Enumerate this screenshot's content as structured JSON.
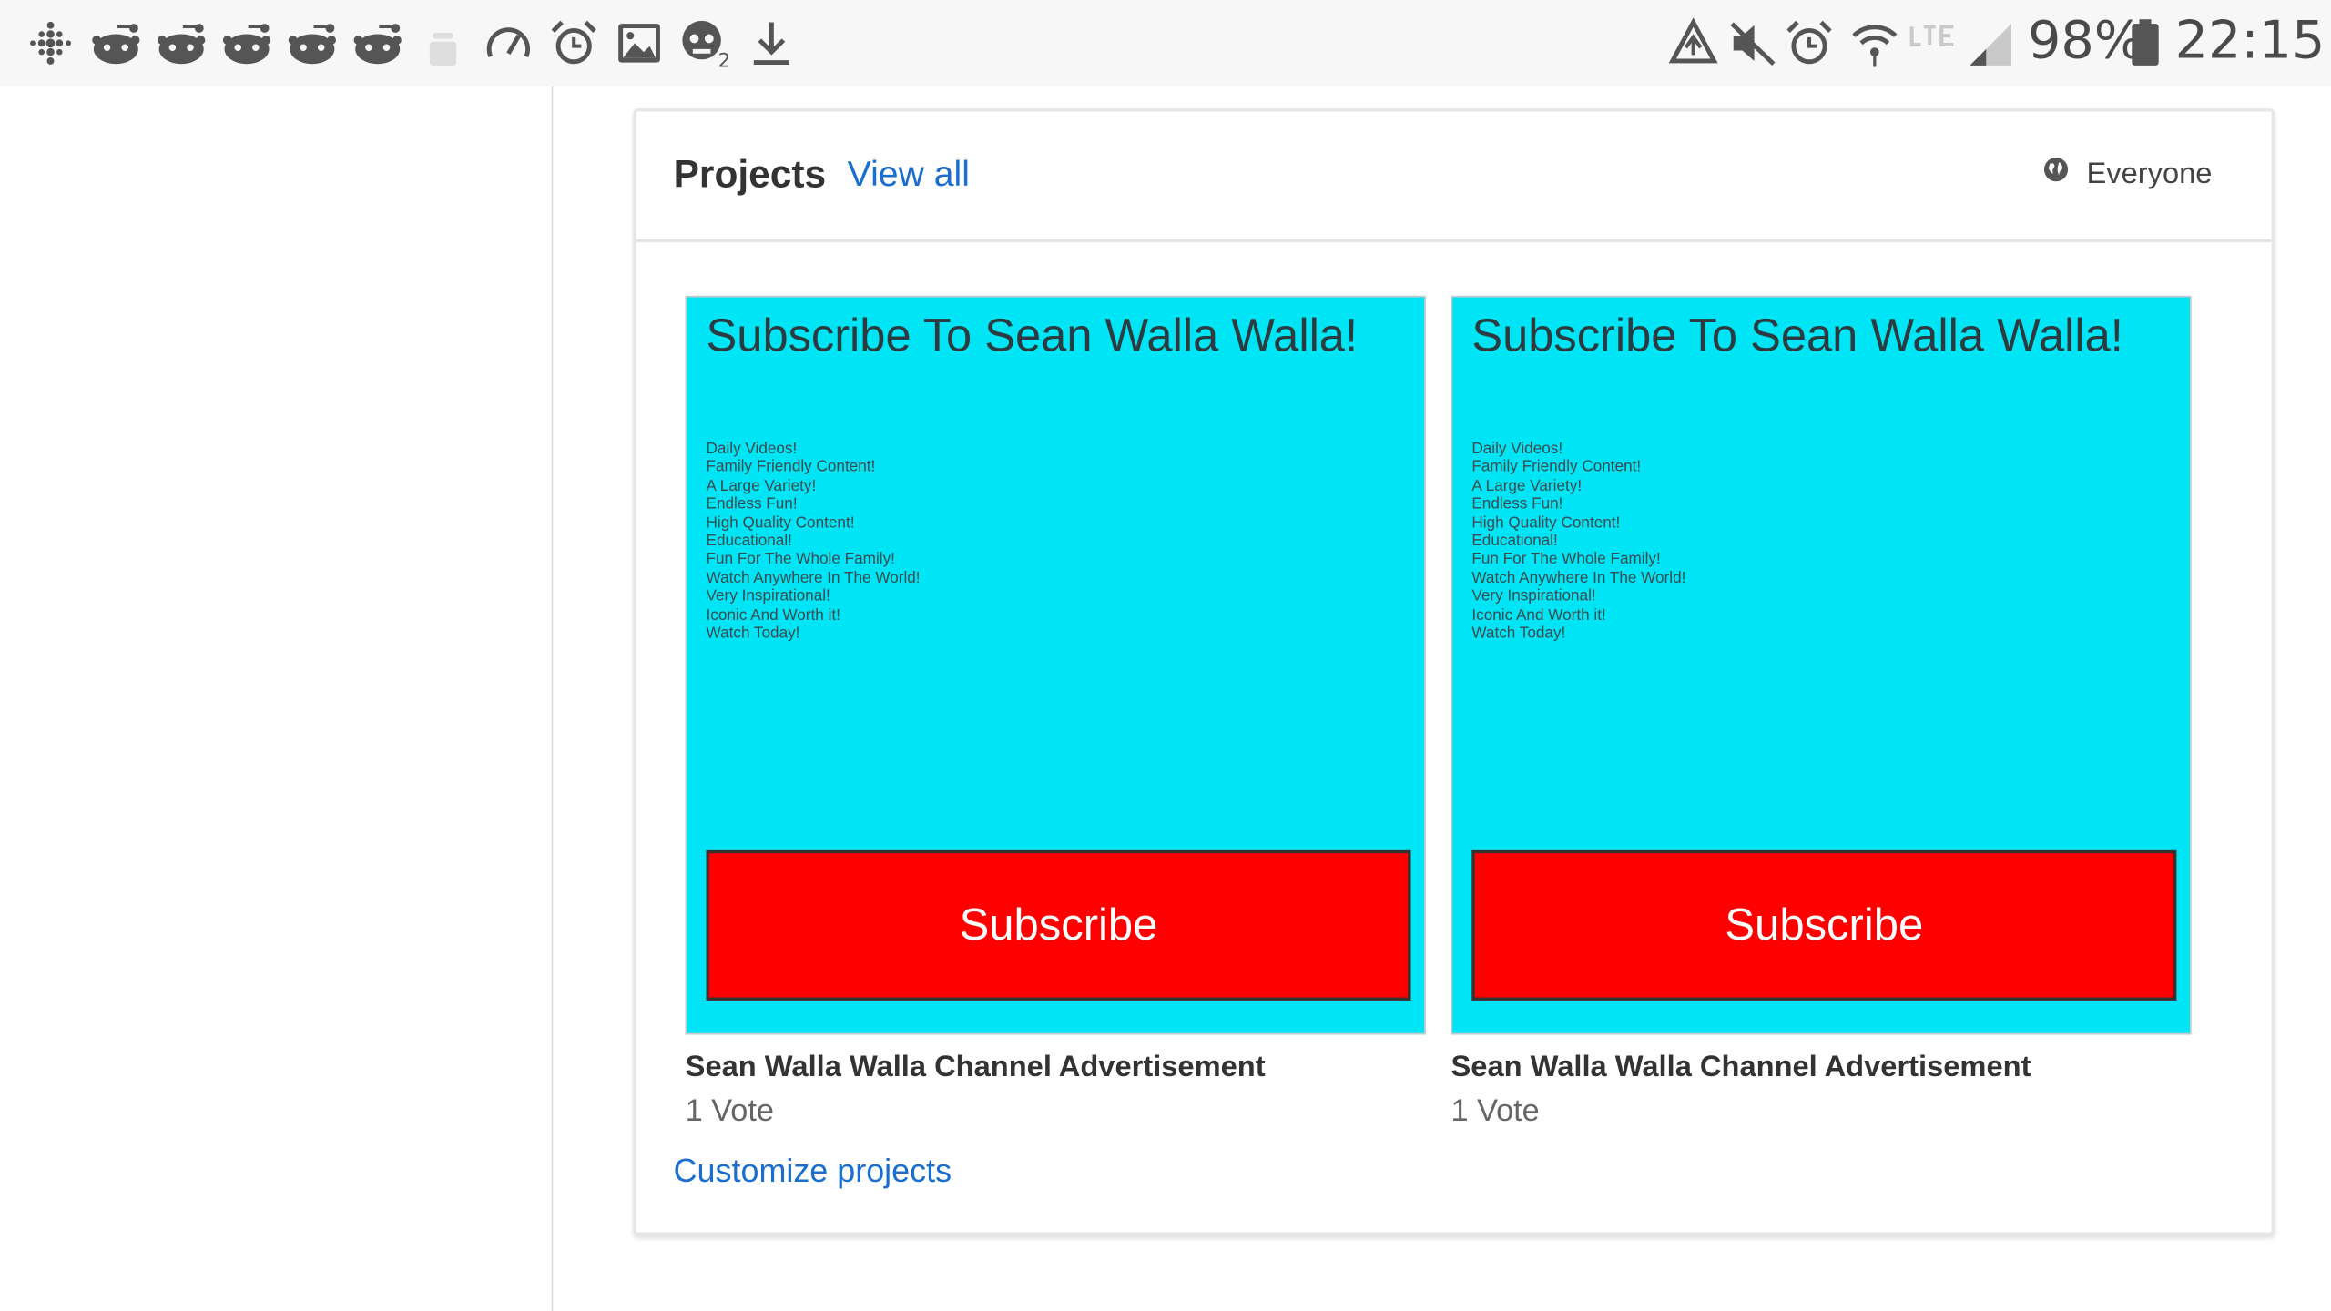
{
  "status_bar": {
    "left_icons": [
      "fitbit-dots-icon",
      "reddit-alien-icon",
      "reddit-alien-icon",
      "reddit-alien-icon",
      "reddit-alien-icon",
      "reddit-alien-icon",
      "android-bot-icon",
      "speedometer-icon",
      "alarm-clock-icon",
      "image-icon",
      "pirate-skull-badge-icon",
      "download-icon"
    ],
    "right_icons": [
      "recycle-sync-icon",
      "mute-icon",
      "alarm-clock-icon",
      "wifi-icon",
      "lte-icon",
      "cell-signal-icon"
    ],
    "battery": "98%",
    "time": "22:15"
  },
  "projects_card": {
    "title": "Projects",
    "view_all": "View all",
    "privacy": "Everyone",
    "customize_link": "Customize projects",
    "projects": [
      {
        "thumbnail": {
          "headline": "Subscribe To Sean Walla Walla!",
          "lines": [
            "Daily Videos!",
            "Family Friendly Content!",
            "A Large Variety!",
            "Endless Fun!",
            "High Quality Content!",
            "Educational!",
            "Fun For The Whole Family!",
            "Watch Anywhere In The World!",
            "Very Inspirational!",
            "Iconic And Worth it!",
            "Watch Today!"
          ],
          "button_label": "Subscribe",
          "background_color": "#00e5f5",
          "button_color": "#ff0000"
        },
        "name": "Sean Walla Walla Channel Advertisement",
        "votes": "1 Vote"
      },
      {
        "thumbnail": {
          "headline": "Subscribe To Sean Walla Walla!",
          "lines": [
            "Daily Videos!",
            "Family Friendly Content!",
            "A Large Variety!",
            "Endless Fun!",
            "High Quality Content!",
            "Educational!",
            "Fun For The Whole Family!",
            "Watch Anywhere In The World!",
            "Very Inspirational!",
            "Iconic And Worth it!",
            "Watch Today!"
          ],
          "button_label": "Subscribe",
          "background_color": "#00e5f5",
          "button_color": "#ff0000"
        },
        "name": "Sean Walla Walla Channel Advertisement",
        "votes": "1 Vote"
      }
    ]
  },
  "colors": {
    "link": "#1a6ed0",
    "status_bar_bg": "#f7f7f7"
  }
}
